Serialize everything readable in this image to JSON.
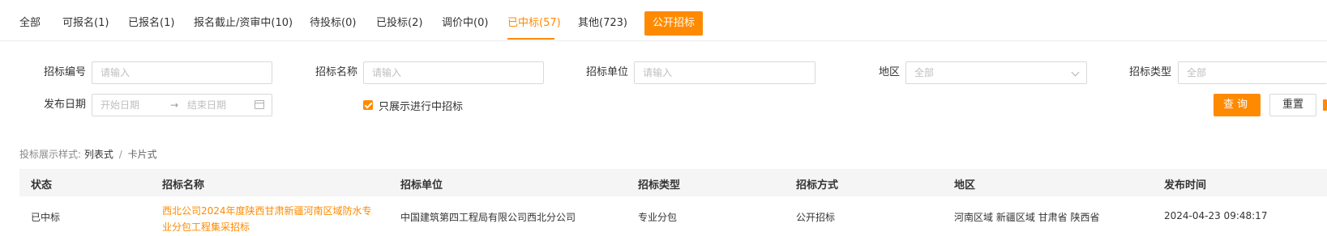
{
  "tabs": [
    {
      "label": "全部",
      "active": false
    },
    {
      "label": "可报名(1)",
      "active": false
    },
    {
      "label": "已报名(1)",
      "active": false
    },
    {
      "label": "报名截止/资审中(10)",
      "active": false
    },
    {
      "label": "待投标(0)",
      "active": false
    },
    {
      "label": "已投标(2)",
      "active": false
    },
    {
      "label": "调价中(0)",
      "active": false
    },
    {
      "label": "已中标(57)",
      "active": true
    },
    {
      "label": "其他(723)",
      "active": false
    }
  ],
  "public_tender_button": "公开招标",
  "filters": {
    "code_label": "招标编号",
    "code_placeholder": "请输入",
    "name_label": "招标名称",
    "name_placeholder": "请输入",
    "unit_label": "招标单位",
    "unit_placeholder": "请输入",
    "region_label": "地区",
    "region_value": "全部",
    "type_label": "招标类型",
    "type_value": "全部",
    "date_label": "发布日期",
    "date_start_placeholder": "开始日期",
    "date_end_placeholder": "结束日期",
    "only_ongoing_label": "只展示进行中招标",
    "only_ongoing_checked": true,
    "query_button": "查询",
    "reset_button": "重置"
  },
  "view_style": {
    "label": "投标展示样式:",
    "list": "列表式",
    "separator": "/",
    "card": "卡片式"
  },
  "table": {
    "headers": [
      "状态",
      "招标名称",
      "招标单位",
      "招标类型",
      "招标方式",
      "地区",
      "发布时间"
    ],
    "rows": [
      {
        "status": "已中标",
        "name": "西北公司2024年度陕西甘肃新疆河南区域防水专业分包工程集采招标",
        "unit": "中国建筑第四工程局有限公司西北分公司",
        "type": "专业分包",
        "method": "公开招标",
        "region": "河南区域 新疆区域 甘肃省 陕西省",
        "time": "2024-04-23 09:48:17"
      }
    ]
  },
  "colors": {
    "accent": "#ff8a00",
    "header_bg": "#f5f5f5",
    "border": "#d9d9d9"
  }
}
